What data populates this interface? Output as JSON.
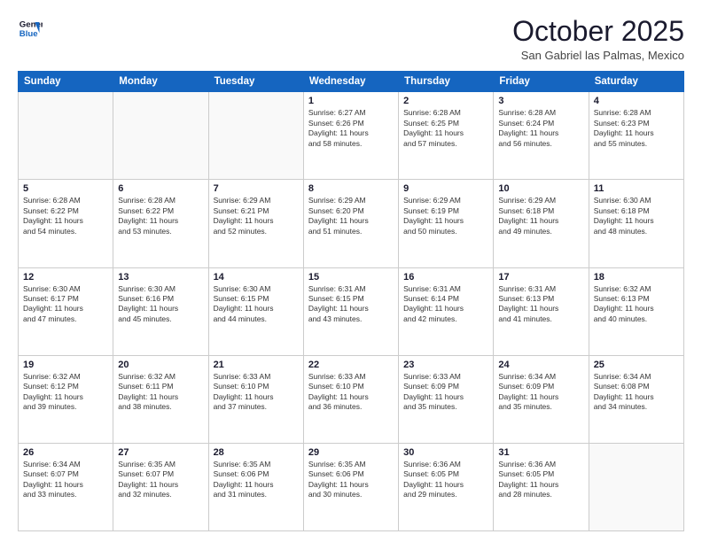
{
  "header": {
    "logo_line1": "General",
    "logo_line2": "Blue",
    "month": "October 2025",
    "location": "San Gabriel las Palmas, Mexico"
  },
  "weekdays": [
    "Sunday",
    "Monday",
    "Tuesday",
    "Wednesday",
    "Thursday",
    "Friday",
    "Saturday"
  ],
  "weeks": [
    [
      {
        "day": "",
        "info": ""
      },
      {
        "day": "",
        "info": ""
      },
      {
        "day": "",
        "info": ""
      },
      {
        "day": "1",
        "info": "Sunrise: 6:27 AM\nSunset: 6:26 PM\nDaylight: 11 hours\nand 58 minutes."
      },
      {
        "day": "2",
        "info": "Sunrise: 6:28 AM\nSunset: 6:25 PM\nDaylight: 11 hours\nand 57 minutes."
      },
      {
        "day": "3",
        "info": "Sunrise: 6:28 AM\nSunset: 6:24 PM\nDaylight: 11 hours\nand 56 minutes."
      },
      {
        "day": "4",
        "info": "Sunrise: 6:28 AM\nSunset: 6:23 PM\nDaylight: 11 hours\nand 55 minutes."
      }
    ],
    [
      {
        "day": "5",
        "info": "Sunrise: 6:28 AM\nSunset: 6:22 PM\nDaylight: 11 hours\nand 54 minutes."
      },
      {
        "day": "6",
        "info": "Sunrise: 6:28 AM\nSunset: 6:22 PM\nDaylight: 11 hours\nand 53 minutes."
      },
      {
        "day": "7",
        "info": "Sunrise: 6:29 AM\nSunset: 6:21 PM\nDaylight: 11 hours\nand 52 minutes."
      },
      {
        "day": "8",
        "info": "Sunrise: 6:29 AM\nSunset: 6:20 PM\nDaylight: 11 hours\nand 51 minutes."
      },
      {
        "day": "9",
        "info": "Sunrise: 6:29 AM\nSunset: 6:19 PM\nDaylight: 11 hours\nand 50 minutes."
      },
      {
        "day": "10",
        "info": "Sunrise: 6:29 AM\nSunset: 6:18 PM\nDaylight: 11 hours\nand 49 minutes."
      },
      {
        "day": "11",
        "info": "Sunrise: 6:30 AM\nSunset: 6:18 PM\nDaylight: 11 hours\nand 48 minutes."
      }
    ],
    [
      {
        "day": "12",
        "info": "Sunrise: 6:30 AM\nSunset: 6:17 PM\nDaylight: 11 hours\nand 47 minutes."
      },
      {
        "day": "13",
        "info": "Sunrise: 6:30 AM\nSunset: 6:16 PM\nDaylight: 11 hours\nand 45 minutes."
      },
      {
        "day": "14",
        "info": "Sunrise: 6:30 AM\nSunset: 6:15 PM\nDaylight: 11 hours\nand 44 minutes."
      },
      {
        "day": "15",
        "info": "Sunrise: 6:31 AM\nSunset: 6:15 PM\nDaylight: 11 hours\nand 43 minutes."
      },
      {
        "day": "16",
        "info": "Sunrise: 6:31 AM\nSunset: 6:14 PM\nDaylight: 11 hours\nand 42 minutes."
      },
      {
        "day": "17",
        "info": "Sunrise: 6:31 AM\nSunset: 6:13 PM\nDaylight: 11 hours\nand 41 minutes."
      },
      {
        "day": "18",
        "info": "Sunrise: 6:32 AM\nSunset: 6:13 PM\nDaylight: 11 hours\nand 40 minutes."
      }
    ],
    [
      {
        "day": "19",
        "info": "Sunrise: 6:32 AM\nSunset: 6:12 PM\nDaylight: 11 hours\nand 39 minutes."
      },
      {
        "day": "20",
        "info": "Sunrise: 6:32 AM\nSunset: 6:11 PM\nDaylight: 11 hours\nand 38 minutes."
      },
      {
        "day": "21",
        "info": "Sunrise: 6:33 AM\nSunset: 6:10 PM\nDaylight: 11 hours\nand 37 minutes."
      },
      {
        "day": "22",
        "info": "Sunrise: 6:33 AM\nSunset: 6:10 PM\nDaylight: 11 hours\nand 36 minutes."
      },
      {
        "day": "23",
        "info": "Sunrise: 6:33 AM\nSunset: 6:09 PM\nDaylight: 11 hours\nand 35 minutes."
      },
      {
        "day": "24",
        "info": "Sunrise: 6:34 AM\nSunset: 6:09 PM\nDaylight: 11 hours\nand 35 minutes."
      },
      {
        "day": "25",
        "info": "Sunrise: 6:34 AM\nSunset: 6:08 PM\nDaylight: 11 hours\nand 34 minutes."
      }
    ],
    [
      {
        "day": "26",
        "info": "Sunrise: 6:34 AM\nSunset: 6:07 PM\nDaylight: 11 hours\nand 33 minutes."
      },
      {
        "day": "27",
        "info": "Sunrise: 6:35 AM\nSunset: 6:07 PM\nDaylight: 11 hours\nand 32 minutes."
      },
      {
        "day": "28",
        "info": "Sunrise: 6:35 AM\nSunset: 6:06 PM\nDaylight: 11 hours\nand 31 minutes."
      },
      {
        "day": "29",
        "info": "Sunrise: 6:35 AM\nSunset: 6:06 PM\nDaylight: 11 hours\nand 30 minutes."
      },
      {
        "day": "30",
        "info": "Sunrise: 6:36 AM\nSunset: 6:05 PM\nDaylight: 11 hours\nand 29 minutes."
      },
      {
        "day": "31",
        "info": "Sunrise: 6:36 AM\nSunset: 6:05 PM\nDaylight: 11 hours\nand 28 minutes."
      },
      {
        "day": "",
        "info": ""
      }
    ]
  ]
}
